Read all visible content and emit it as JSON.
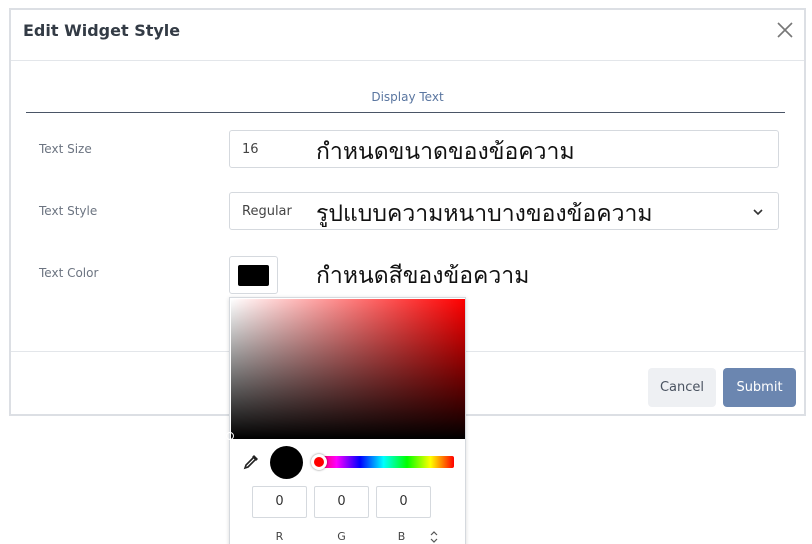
{
  "dialog": {
    "title": "Edit Widget Style",
    "tab": "Display Text"
  },
  "fields": {
    "text_size": {
      "label": "Text Size",
      "value": "16",
      "annotation": "กำหนดขนาดของข้อความ"
    },
    "text_style": {
      "label": "Text Style",
      "value": "Regular",
      "annotation": "รูปแบบความหนาบางของข้อความ"
    },
    "text_color": {
      "label": "Text Color",
      "value": "#000000",
      "annotation": "กำหนดสีของข้อความ"
    }
  },
  "buttons": {
    "cancel": "Cancel",
    "submit": "Submit"
  },
  "color_picker": {
    "r": "0",
    "g": "0",
    "b": "0",
    "r_label": "R",
    "g_label": "G",
    "b_label": "B",
    "hue_color": "#ff0000",
    "selected_color": "#000000"
  },
  "colors": {
    "accent": "#6b86b0",
    "tab_text": "#5a76a0"
  }
}
